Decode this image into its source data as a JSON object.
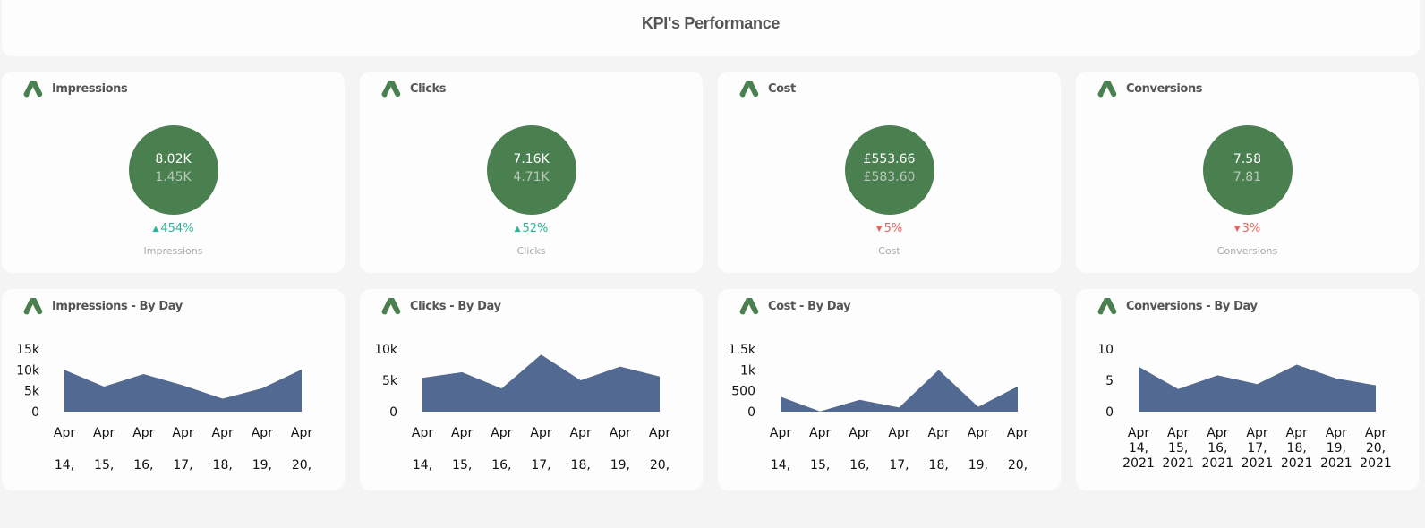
{
  "header": {
    "title": "KPI's Performance"
  },
  "colors": {
    "kpi_circle": "#4a7f4f",
    "up": "#2bb59a",
    "down": "#e8655f",
    "area": "#526a92",
    "icon": "#4a7f4f"
  },
  "kpis": [
    {
      "title": "Impressions",
      "current": "8.02K",
      "previous": "1.45K",
      "direction": "up",
      "change": "454%",
      "label": "Impressions",
      "icon": "google-ads-icon"
    },
    {
      "title": "Clicks",
      "current": "7.16K",
      "previous": "4.71K",
      "direction": "up",
      "change": "52%",
      "label": "Clicks",
      "icon": "google-ads-icon"
    },
    {
      "title": "Cost",
      "current": "£553.66",
      "previous": "£583.60",
      "direction": "down",
      "change": "5%",
      "label": "Cost",
      "icon": "google-ads-icon"
    },
    {
      "title": "Conversions",
      "current": "7.58",
      "previous": "7.81",
      "direction": "down",
      "change": "3%",
      "label": "Conversions",
      "icon": "google-ads-icon"
    }
  ],
  "chart_data": [
    {
      "type": "area",
      "title": "Impressions - By Day",
      "categories": [
        "Apr 14, 2021",
        "Apr 15, 2021",
        "Apr 16, 2021",
        "Apr 17, 2021",
        "Apr 18, 2021",
        "Apr 19, 2021",
        "Apr 20, 2021"
      ],
      "tick_lines": [
        [
          "Apr",
          "14,"
        ],
        [
          "Apr",
          "15,"
        ],
        [
          "Apr",
          "16,"
        ],
        [
          "Apr",
          "17,"
        ],
        [
          "Apr",
          "18,"
        ],
        [
          "Apr",
          "19,"
        ],
        [
          "Apr",
          "20,"
        ]
      ],
      "values": [
        10000,
        6000,
        9000,
        6300,
        3100,
        5600,
        10100
      ],
      "ylim": [
        0,
        15000
      ],
      "yticks": [
        0,
        5000,
        10000,
        15000
      ],
      "ytick_labels": [
        "0",
        "5k",
        "10k",
        "15k"
      ],
      "xlabel": "",
      "ylabel": "",
      "grid": false,
      "legend": "none"
    },
    {
      "type": "area",
      "title": "Clicks - By Day",
      "categories": [
        "Apr 14, 2021",
        "Apr 15, 2021",
        "Apr 16, 2021",
        "Apr 17, 2021",
        "Apr 18, 2021",
        "Apr 19, 2021",
        "Apr 20, 2021"
      ],
      "tick_lines": [
        [
          "Apr",
          "14,"
        ],
        [
          "Apr",
          "15,"
        ],
        [
          "Apr",
          "16,"
        ],
        [
          "Apr",
          "17,"
        ],
        [
          "Apr",
          "18,"
        ],
        [
          "Apr",
          "19,"
        ],
        [
          "Apr",
          "20,"
        ]
      ],
      "values": [
        5400,
        6300,
        3700,
        9100,
        5000,
        7200,
        5600
      ],
      "ylim": [
        0,
        10000
      ],
      "yticks": [
        0,
        5000,
        10000
      ],
      "ytick_labels": [
        "0",
        "5k",
        "10k"
      ],
      "xlabel": "",
      "ylabel": "",
      "grid": false,
      "legend": "none"
    },
    {
      "type": "area",
      "title": "Cost - By Day",
      "categories": [
        "Apr 14, 2021",
        "Apr 15, 2021",
        "Apr 16, 2021",
        "Apr 17, 2021",
        "Apr 18, 2021",
        "Apr 19, 2021",
        "Apr 20, 2021"
      ],
      "tick_lines": [
        [
          "Apr",
          "14,"
        ],
        [
          "Apr",
          "15,"
        ],
        [
          "Apr",
          "16,"
        ],
        [
          "Apr",
          "17,"
        ],
        [
          "Apr",
          "18,"
        ],
        [
          "Apr",
          "19,"
        ],
        [
          "Apr",
          "20,"
        ]
      ],
      "values": [
        360,
        5,
        285,
        100,
        1000,
        115,
        605
      ],
      "ylim": [
        0,
        1500
      ],
      "yticks": [
        0,
        500,
        1000,
        1500
      ],
      "ytick_labels": [
        "0",
        "500",
        "1k",
        "1.5k"
      ],
      "xlabel": "",
      "ylabel": "",
      "grid": false,
      "legend": "none"
    },
    {
      "type": "area",
      "title": "Conversions - By Day",
      "categories": [
        "Apr 14, 2021",
        "Apr 15, 2021",
        "Apr 16, 2021",
        "Apr 17, 2021",
        "Apr 18, 2021",
        "Apr 19, 2021",
        "Apr 20, 2021"
      ],
      "tick_lines": [
        [
          "Apr",
          "14,",
          "2021"
        ],
        [
          "Apr",
          "15,",
          "2021"
        ],
        [
          "Apr",
          "16,",
          "2021"
        ],
        [
          "Apr",
          "17,",
          "2021"
        ],
        [
          "Apr",
          "18,",
          "2021"
        ],
        [
          "Apr",
          "19,",
          "2021"
        ],
        [
          "Apr",
          "20,",
          "2021"
        ]
      ],
      "values": [
        7.2,
        3.6,
        5.8,
        4.4,
        7.5,
        5.3,
        4.2
      ],
      "ylim": [
        0,
        10
      ],
      "yticks": [
        0,
        5,
        10
      ],
      "ytick_labels": [
        "0",
        "5",
        "10"
      ],
      "xlabel": "",
      "ylabel": "",
      "grid": false,
      "legend": "none"
    }
  ]
}
